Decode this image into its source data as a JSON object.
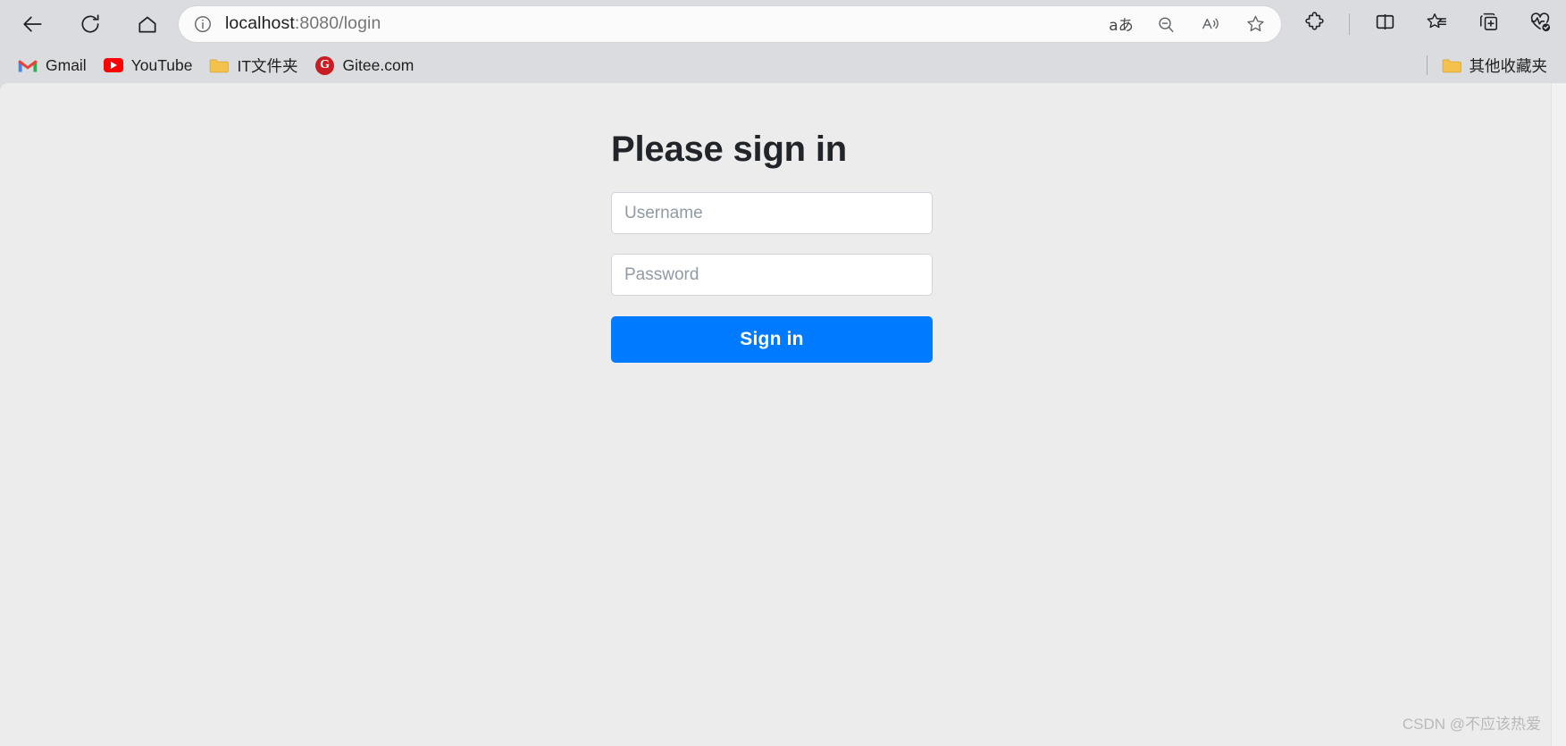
{
  "browser": {
    "nav": {
      "back_label": "Back",
      "refresh_label": "Refresh",
      "home_label": "Home"
    },
    "omnibox": {
      "host": "localhost",
      "path": ":8080/login",
      "full_url": "localhost:8080/login",
      "site_info_label": "View site information",
      "actions": [
        {
          "name": "translate",
          "label": "Translate this page",
          "glyph": "aあ"
        },
        {
          "name": "zoom-out",
          "label": "Zoom out"
        },
        {
          "name": "read-aloud",
          "label": "Read this page aloud"
        },
        {
          "name": "favorite",
          "label": "Add this page to favorites"
        }
      ]
    },
    "toolbar_right": [
      {
        "name": "extensions",
        "label": "Extensions"
      },
      {
        "name": "split-screen",
        "label": "Split screen"
      },
      {
        "name": "favorites",
        "label": "Favorites"
      },
      {
        "name": "collections",
        "label": "Collections"
      },
      {
        "name": "browser-essentials",
        "label": "Browser essentials"
      }
    ],
    "bookmarks": [
      {
        "label": "Gmail",
        "icon": "gmail-icon"
      },
      {
        "label": "YouTube",
        "icon": "youtube-icon"
      },
      {
        "label": "IT文件夹",
        "icon": "folder-icon"
      },
      {
        "label": "Gitee.com",
        "icon": "gitee-icon"
      }
    ],
    "other_favorites": {
      "label": "其他收藏夹",
      "icon": "folder-icon"
    }
  },
  "page": {
    "title": "Please sign in",
    "username": {
      "placeholder": "Username",
      "value": ""
    },
    "password": {
      "placeholder": "Password",
      "value": ""
    },
    "submit_label": "Sign in",
    "accent_color": "#007bff",
    "background_color": "#ececec",
    "watermark": "CSDN @不应该热爱"
  }
}
